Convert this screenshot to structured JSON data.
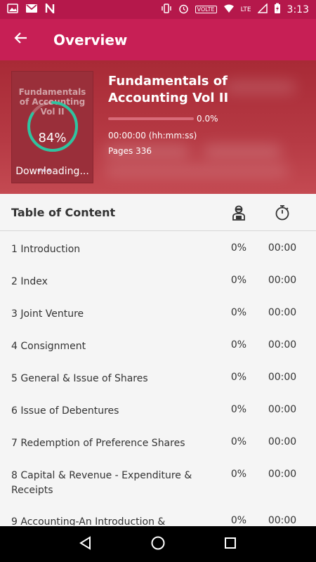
{
  "status_bar": {
    "time": "3:13",
    "network_label": "VOLTE",
    "lte_label": "LTE",
    "icons": [
      "photo-icon",
      "gmail-icon",
      "n-app-icon",
      "vibrate-icon",
      "alarm-icon",
      "wifi-icon",
      "signal-icon",
      "battery-icon"
    ]
  },
  "app_bar": {
    "title": "Overview",
    "back_icon": "arrow-back-icon"
  },
  "book": {
    "cover_title": "Fundamentals of Accounting Vol II",
    "download_percent_label": "84%",
    "download_progress": 0.84,
    "download_status": "Downloading...",
    "title": "Fundamentals of Accounting Vol II",
    "read_progress_label": "0.0%",
    "read_progress": 0.0,
    "time_read": "00:00:00 (hh:mm:ss)",
    "pages": "Pages 336",
    "accent_ring_color": "#2ec4a0"
  },
  "toc": {
    "title": "Table of Content",
    "progress_column_icon": "reader-icon",
    "time_column_icon": "stopwatch-icon",
    "rows": [
      {
        "label": "1 Introduction",
        "percent": "0%",
        "time": "00:00"
      },
      {
        "label": "2 Index",
        "percent": "0%",
        "time": "00:00"
      },
      {
        "label": "3 Joint Venture",
        "percent": "0%",
        "time": "00:00"
      },
      {
        "label": "4 Consignment",
        "percent": "0%",
        "time": "00:00"
      },
      {
        "label": "5 General & Issue of Shares",
        "percent": "0%",
        "time": "00:00"
      },
      {
        "label": "6 Issue of Debentures",
        "percent": "0%",
        "time": "00:00"
      },
      {
        "label": "7 Redemption of Preference Shares",
        "percent": "0%",
        "time": "00:00"
      },
      {
        "label": "8 Capital & Revenue - Expenditure & Receipts",
        "percent": "0%",
        "time": "00:00"
      },
      {
        "label": "9 Accounting-An Introduction &",
        "percent": "0%",
        "time": "00:00"
      }
    ]
  },
  "nav_bar": {
    "icons": [
      "back-triangle-icon",
      "home-circle-icon",
      "recents-square-icon"
    ]
  },
  "colors": {
    "status_bar": "#b5184b",
    "app_bar": "#c71f55",
    "hero": "#b03640",
    "background": "#f5f5f5"
  }
}
